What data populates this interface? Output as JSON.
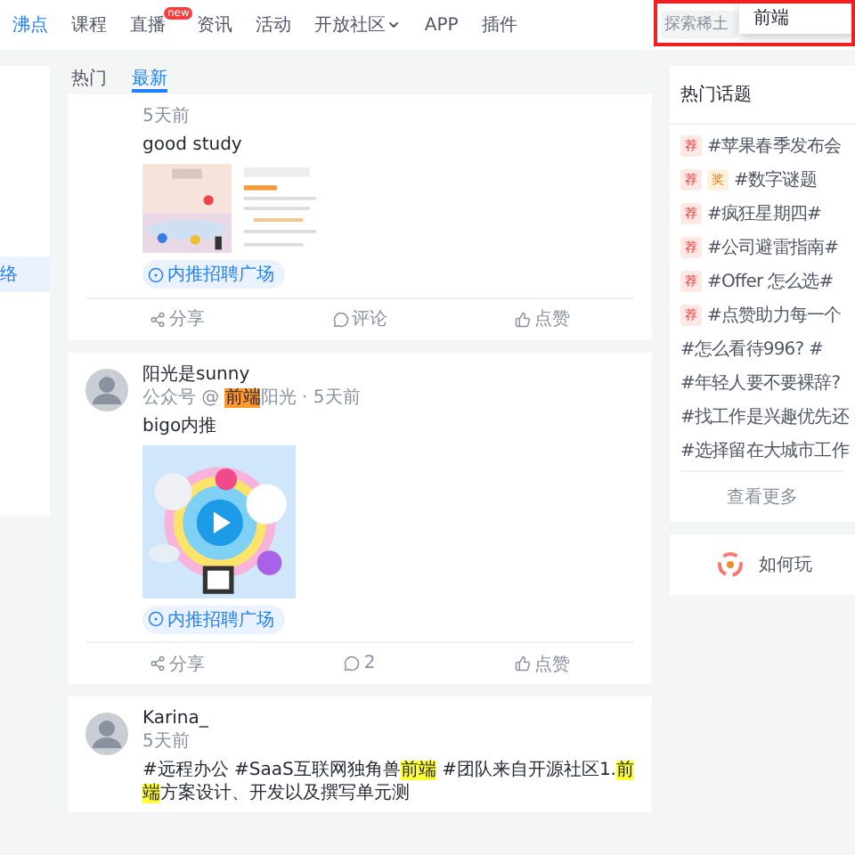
{
  "nav": {
    "items": [
      {
        "label": "沸点",
        "selected": true
      },
      {
        "label": "课程",
        "selected": false
      },
      {
        "label": "直播",
        "selected": false,
        "badge": "new"
      },
      {
        "label": "资讯",
        "selected": false
      },
      {
        "label": "活动",
        "selected": false
      },
      {
        "label": "开放社区",
        "selected": false,
        "dropdown": true
      },
      {
        "label": "APP",
        "selected": false
      },
      {
        "label": "插件",
        "selected": false
      }
    ],
    "search": {
      "placeholder": "探索稀土",
      "dropdown_value": "前端",
      "annotation_frame": true
    }
  },
  "sidebar": {
    "items": [
      {
        "label": "络",
        "selected": true
      }
    ]
  },
  "feed_tabs": [
    {
      "label": "热门",
      "selected": false
    },
    {
      "label": "最新",
      "selected": true
    }
  ],
  "posts": [
    {
      "meta": [
        {
          "text": "5天前"
        }
      ],
      "text": [
        {
          "text": "good study"
        }
      ],
      "pictures": [
        {
          "kind": "picture"
        },
        {
          "kind": "picture"
        }
      ],
      "tag": "内推招聘广场",
      "actions": [
        {
          "kind": "share",
          "label": "分享"
        },
        {
          "kind": "comment",
          "label": "评论"
        },
        {
          "kind": "like",
          "label": "点赞"
        }
      ]
    },
    {
      "author": "阳光是sunny",
      "meta": [
        {
          "text": "公众号 @ "
        },
        {
          "text": "前端",
          "color": "#ff9a2e"
        },
        {
          "text": "阳光 · 5天前"
        }
      ],
      "text": [
        {
          "text": "bigo内推"
        }
      ],
      "pictures": [
        {
          "kind": "picture"
        }
      ],
      "tag": "内推招聘广场",
      "actions": [
        {
          "kind": "share",
          "label": "分享"
        },
        {
          "kind": "comment",
          "label": "2"
        },
        {
          "kind": "like",
          "label": "点赞"
        }
      ]
    },
    {
      "author": "Karina_",
      "meta": [
        {
          "text": "5天前"
        }
      ],
      "text": [
        {
          "text": "#远程办公 #SaaS互联网独角兽"
        },
        {
          "text": "前端",
          "color": "#ffff33"
        },
        {
          "text": " #团队来自开源社区1."
        },
        {
          "text": "前端",
          "color": "#ffff33"
        },
        {
          "text": "方案设计、开发以及撰写单元测"
        }
      ]
    }
  ],
  "hot_topics": {
    "title": "热门话题",
    "items": [
      {
        "text": "#苹果春季发布会",
        "badges": [
          {
            "text": "荐",
            "color": "#fde8e4"
          }
        ]
      },
      {
        "text": "#数字谜题",
        "badges": [
          {
            "text": "荐",
            "color": "#fde8e4"
          },
          {
            "text": "奖",
            "color": "#fff1dc"
          }
        ]
      },
      {
        "text": "#疯狂星期四#",
        "badges": [
          {
            "text": "荐",
            "color": "#fde8e4"
          }
        ]
      },
      {
        "text": "#公司避雷指南#",
        "badges": [
          {
            "text": "荐",
            "color": "#fde8e4"
          }
        ]
      },
      {
        "text": "#Offer 怎么选#",
        "badges": [
          {
            "text": "荐",
            "color": "#fde8e4"
          }
        ]
      },
      {
        "text": "#点赞助力每一个",
        "badges": [
          {
            "text": "荐",
            "color": "#fde8e4"
          }
        ]
      },
      {
        "text": "#怎么看待996? #"
      },
      {
        "text": "#年轻人要不要裸辞?"
      },
      {
        "text": "#找工作是兴趣优先还"
      },
      {
        "text": "#选择留在大城市工作"
      }
    ],
    "more": "查看更多"
  },
  "guide": {
    "label": "如何玩"
  }
}
